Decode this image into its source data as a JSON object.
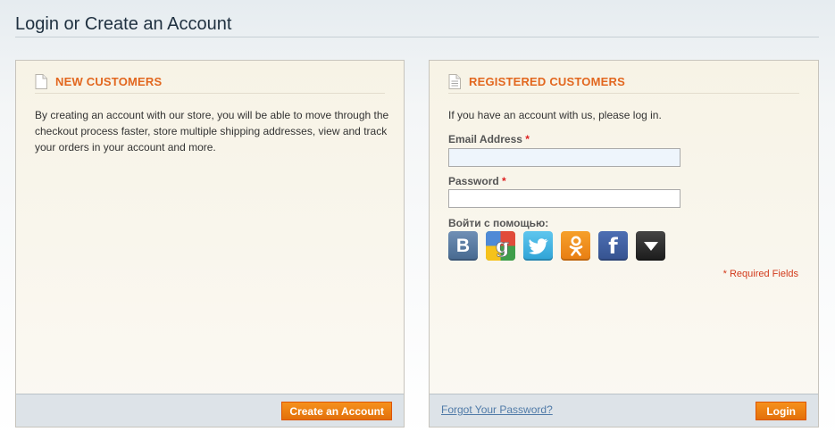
{
  "page": {
    "title": "Login or Create an Account"
  },
  "new_customers": {
    "title": "NEW CUSTOMERS",
    "intro": "By creating an account with our store, you will be able to move through the checkout process faster, store multiple shipping addresses, view and track your orders in your account and more.",
    "create_button": "Create an Account"
  },
  "registered": {
    "title": "REGISTERED CUSTOMERS",
    "intro": "If you have an account with us, please log in.",
    "email_label": "Email Address",
    "email_value": "",
    "password_label": "Password",
    "password_value": "",
    "required_mark": "*",
    "social_label": "Войти с помощью:",
    "social": [
      {
        "name": "vkontakte",
        "text": "B",
        "icon": "vk-icon",
        "color": "#5a7da8"
      },
      {
        "name": "google",
        "icon": "google-icon",
        "color": "#6aa84f"
      },
      {
        "name": "twitter",
        "icon": "twitter-icon",
        "color": "#3fb3e3"
      },
      {
        "name": "odnoklassniki",
        "icon": "odnoklassniki-icon",
        "color": "#f08d1e"
      },
      {
        "name": "facebook",
        "text": "f",
        "icon": "facebook-icon",
        "color": "#3b5998"
      },
      {
        "name": "more",
        "icon": "triangle-down-icon",
        "color": "#2b2b2b"
      }
    ],
    "required_fields": "* Required Fields",
    "forgot_link": "Forgot Your Password?",
    "login_button": "Login"
  },
  "colors": {
    "accent": "#e2671f",
    "button": "#f18313",
    "link": "#507ba8",
    "required": "#d23a1c"
  }
}
